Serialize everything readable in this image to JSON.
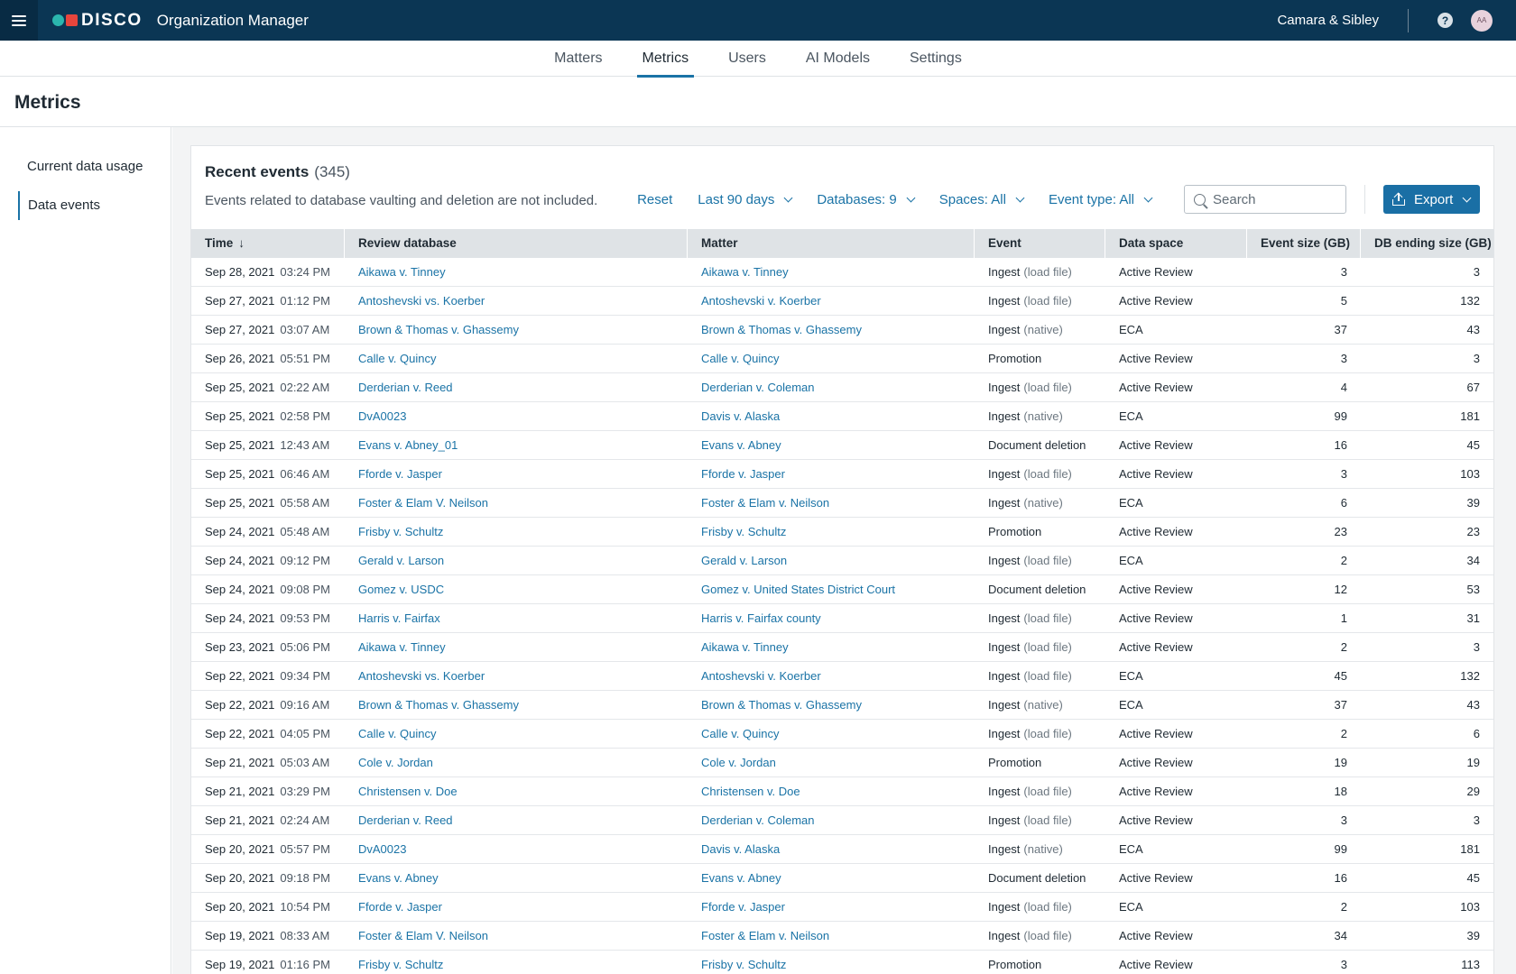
{
  "header": {
    "brand": "DISCO",
    "app_title": "Organization Manager",
    "org_name": "Camara & Sibley",
    "help_label": "?",
    "avatar_initials": "AA"
  },
  "nav": {
    "tabs": [
      {
        "label": "Matters"
      },
      {
        "label": "Metrics"
      },
      {
        "label": "Users"
      },
      {
        "label": "AI Models"
      },
      {
        "label": "Settings"
      }
    ],
    "active": "Metrics"
  },
  "page_title": "Metrics",
  "sidebar": {
    "items": [
      {
        "label": "Current data usage"
      },
      {
        "label": "Data events"
      }
    ],
    "active": "Data events"
  },
  "card": {
    "title": "Recent events",
    "count": "(345)",
    "subtitle": "Events related to database vaulting and deletion are not included."
  },
  "filters": {
    "reset": "Reset",
    "date_range": "Last 90 days",
    "databases": "Databases: 9",
    "spaces": "Spaces: All",
    "event_type": "Event type: All",
    "search_placeholder": "Search",
    "export": "Export"
  },
  "table": {
    "columns": [
      "Time",
      "Review database",
      "Matter",
      "Event",
      "Data space",
      "Event size (GB)",
      "DB ending size (GB)"
    ],
    "sort_indicator": "↓",
    "rows": [
      {
        "date": "Sep 28, 2021",
        "time": "03:24 PM",
        "db": "Aikawa v. Tinney",
        "matter": "Aikawa v. Tinney",
        "event": "Ingest",
        "event_sub": "(load file)",
        "space": "Active Review",
        "size": "3",
        "ending": "3"
      },
      {
        "date": "Sep 27, 2021",
        "time": "01:12 PM",
        "db": "Antoshevski vs. Koerber",
        "matter": "Antoshevski v. Koerber",
        "event": "Ingest",
        "event_sub": "(load file)",
        "space": "Active Review",
        "size": "5",
        "ending": "132"
      },
      {
        "date": "Sep 27, 2021",
        "time": "03:07 AM",
        "db": "Brown & Thomas v. Ghassemy",
        "matter": "Brown & Thomas v. Ghassemy",
        "event": "Ingest",
        "event_sub": "(native)",
        "space": "ECA",
        "size": "37",
        "ending": "43"
      },
      {
        "date": "Sep 26, 2021",
        "time": "05:51 PM",
        "db": "Calle v. Quincy",
        "matter": "Calle v. Quincy",
        "event": "Promotion",
        "event_sub": "",
        "space": "Active Review",
        "size": "3",
        "ending": "3"
      },
      {
        "date": "Sep 25, 2021",
        "time": "02:22 AM",
        "db": "Derderian v. Reed",
        "matter": "Derderian v. Coleman",
        "event": "Ingest",
        "event_sub": "(load file)",
        "space": "Active Review",
        "size": "4",
        "ending": "67"
      },
      {
        "date": "Sep 25, 2021",
        "time": "02:58 PM",
        "db": "DvA0023",
        "matter": "Davis v. Alaska",
        "event": "Ingest",
        "event_sub": "(native)",
        "space": "ECA",
        "size": "99",
        "ending": "181"
      },
      {
        "date": "Sep 25, 2021",
        "time": "12:43 AM",
        "db": "Evans v. Abney_01",
        "matter": "Evans v. Abney",
        "event": "Document deletion",
        "event_sub": "",
        "space": "Active Review",
        "size": "16",
        "ending": "45"
      },
      {
        "date": "Sep 25, 2021",
        "time": "06:46 AM",
        "db": "Fforde v. Jasper",
        "matter": "Fforde v. Jasper",
        "event": "Ingest",
        "event_sub": "(load file)",
        "space": "Active Review",
        "size": "3",
        "ending": "103"
      },
      {
        "date": "Sep 25, 2021",
        "time": "05:58 AM",
        "db": "Foster & Elam V. Neilson",
        "matter": "Foster & Elam v. Neilson",
        "event": "Ingest",
        "event_sub": "(native)",
        "space": "ECA",
        "size": "6",
        "ending": "39"
      },
      {
        "date": "Sep 24, 2021",
        "time": "05:48 AM",
        "db": "Frisby v. Schultz",
        "matter": "Frisby v. Schultz",
        "event": "Promotion",
        "event_sub": "",
        "space": "Active Review",
        "size": "23",
        "ending": "23"
      },
      {
        "date": "Sep 24, 2021",
        "time": "09:12 PM",
        "db": "Gerald v. Larson",
        "matter": "Gerald v. Larson",
        "event": "Ingest",
        "event_sub": "(load file)",
        "space": "ECA",
        "size": "2",
        "ending": "34"
      },
      {
        "date": "Sep 24, 2021",
        "time": "09:08 PM",
        "db": "Gomez v. USDC",
        "matter": "Gomez v. United States District Court",
        "event": "Document deletion",
        "event_sub": "",
        "space": "Active Review",
        "size": "12",
        "ending": "53"
      },
      {
        "date": "Sep 24, 2021",
        "time": "09:53 PM",
        "db": "Harris v. Fairfax",
        "matter": "Harris v. Fairfax county",
        "event": "Ingest",
        "event_sub": "(load file)",
        "space": "Active Review",
        "size": "1",
        "ending": "31"
      },
      {
        "date": "Sep 23, 2021",
        "time": "05:06 PM",
        "db": "Aikawa v. Tinney",
        "matter": "Aikawa v. Tinney",
        "event": "Ingest",
        "event_sub": "(load file)",
        "space": "Active Review",
        "size": "2",
        "ending": "3"
      },
      {
        "date": "Sep 22, 2021",
        "time": "09:34 PM",
        "db": "Antoshevski vs. Koerber",
        "matter": "Antoshevski v. Koerber",
        "event": "Ingest",
        "event_sub": "(load file)",
        "space": "ECA",
        "size": "45",
        "ending": "132"
      },
      {
        "date": "Sep 22, 2021",
        "time": "09:16 AM",
        "db": "Brown & Thomas v. Ghassemy",
        "matter": "Brown & Thomas v. Ghassemy",
        "event": "Ingest",
        "event_sub": "(native)",
        "space": "ECA",
        "size": "37",
        "ending": "43"
      },
      {
        "date": "Sep 22, 2021",
        "time": "04:05 PM",
        "db": "Calle v. Quincy",
        "matter": "Calle v. Quincy",
        "event": "Ingest",
        "event_sub": "(load file)",
        "space": "Active Review",
        "size": "2",
        "ending": "6"
      },
      {
        "date": "Sep 21, 2021",
        "time": "05:03 AM",
        "db": "Cole v. Jordan",
        "matter": "Cole v. Jordan",
        "event": "Promotion",
        "event_sub": "",
        "space": "Active Review",
        "size": "19",
        "ending": "19"
      },
      {
        "date": "Sep 21, 2021",
        "time": "03:29 PM",
        "db": "Christensen v. Doe",
        "matter": "Christensen v. Doe",
        "event": "Ingest",
        "event_sub": "(load file)",
        "space": "Active Review",
        "size": "18",
        "ending": "29"
      },
      {
        "date": "Sep 21, 2021",
        "time": "02:24 AM",
        "db": "Derderian v. Reed",
        "matter": "Derderian v. Coleman",
        "event": "Ingest",
        "event_sub": "(load file)",
        "space": "Active Review",
        "size": "3",
        "ending": "3"
      },
      {
        "date": "Sep 20, 2021",
        "time": "05:57 PM",
        "db": "DvA0023",
        "matter": "Davis v. Alaska",
        "event": "Ingest",
        "event_sub": "(native)",
        "space": "ECA",
        "size": "99",
        "ending": "181"
      },
      {
        "date": "Sep 20, 2021",
        "time": "09:18 PM",
        "db": "Evans v. Abney",
        "matter": "Evans v. Abney",
        "event": "Document deletion",
        "event_sub": "",
        "space": "Active Review",
        "size": "16",
        "ending": "45"
      },
      {
        "date": "Sep 20, 2021",
        "time": "10:54 PM",
        "db": "Fforde v. Jasper",
        "matter": "Fforde v. Jasper",
        "event": "Ingest",
        "event_sub": "(load file)",
        "space": "ECA",
        "size": "2",
        "ending": "103"
      },
      {
        "date": "Sep 19, 2021",
        "time": "08:33 AM",
        "db": "Foster & Elam V. Neilson",
        "matter": "Foster & Elam v. Neilson",
        "event": "Ingest",
        "event_sub": "(load file)",
        "space": "Active Review",
        "size": "34",
        "ending": "39"
      },
      {
        "date": "Sep 19, 2021",
        "time": "01:16 PM",
        "db": "Frisby v. Schultz",
        "matter": "Frisby v. Schultz",
        "event": "Promotion",
        "event_sub": "",
        "space": "Active Review",
        "size": "3",
        "ending": "113"
      }
    ]
  }
}
